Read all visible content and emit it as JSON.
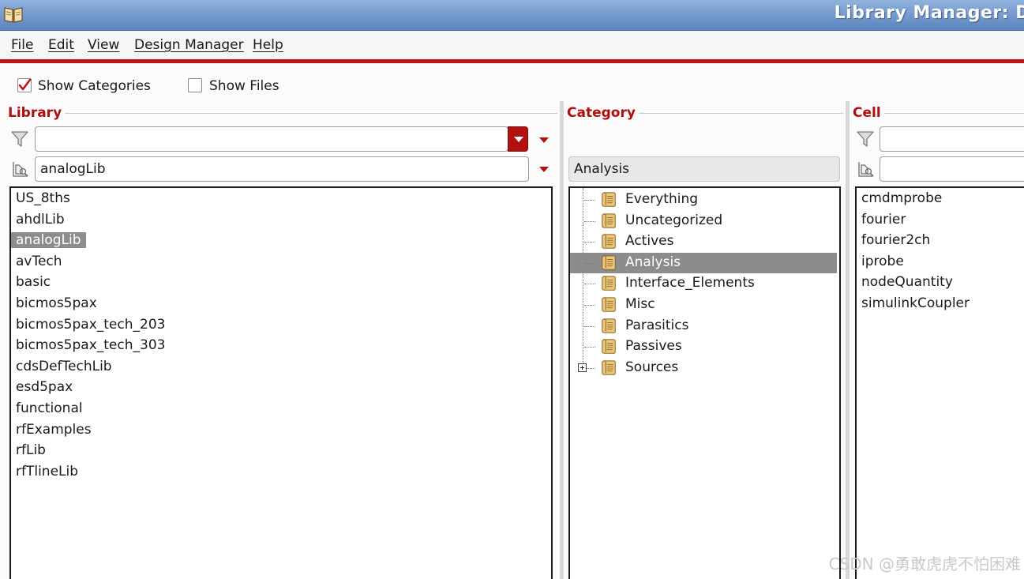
{
  "window": {
    "title": "Library Manager: D"
  },
  "menu": [
    "File",
    "Edit",
    "View",
    "Design Manager",
    "Help"
  ],
  "options": {
    "show_categories": "Show Categories",
    "show_files": "Show Files"
  },
  "library": {
    "header": "Library",
    "filter_value": "",
    "current_value": "analogLib",
    "items": [
      "US_8ths",
      "ahdlLib",
      "analogLib",
      "avTech",
      "basic",
      "bicmos5pax",
      "bicmos5pax_tech_203",
      "bicmos5pax_tech_303",
      "cdsDefTechLib",
      "esd5pax",
      "functional",
      "rfExamples",
      "rfLib",
      "rfTlineLib"
    ],
    "selected": "analogLib"
  },
  "category": {
    "header": "Category",
    "current_value": "Analysis",
    "items": [
      "Everything",
      "Uncategorized",
      "Actives",
      "Analysis",
      "Interface_Elements",
      "Misc",
      "Parasitics",
      "Passives",
      "Sources"
    ],
    "selected": "Analysis",
    "expandable": "Sources"
  },
  "cell": {
    "header": "Cell",
    "filter_value": "",
    "current_value": "",
    "items": [
      "cmdmprobe",
      "fourier",
      "fourier2ch",
      "iprobe",
      "nodeQuantity",
      "simulinkCoupler"
    ]
  },
  "watermark": "CSDN @勇敢虎虎不怕困难",
  "colors": {
    "accent": "#b31010",
    "selection": "#8c8c8c",
    "title_bar": "#6f93c8"
  },
  "icons": {
    "app": "book-icon",
    "filter": "filter-icon",
    "browse": "browse-icon",
    "category": "scroll-icon",
    "expander": "plus-icon"
  }
}
